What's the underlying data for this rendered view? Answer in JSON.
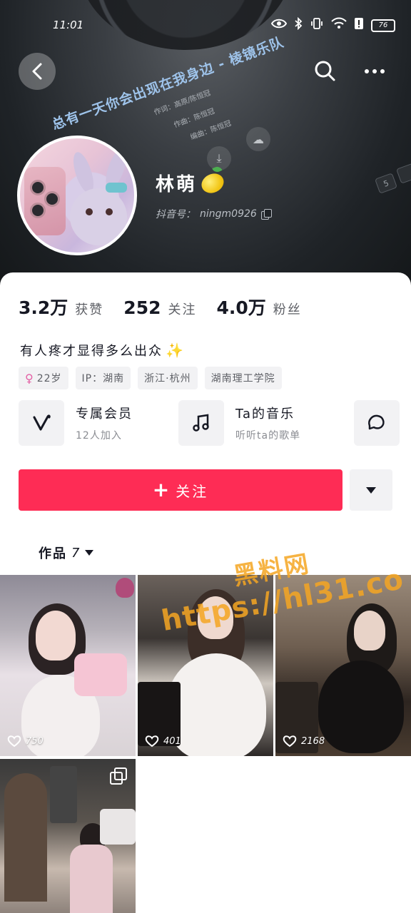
{
  "status_bar": {
    "time": "11:01",
    "battery": "76",
    "icons": [
      "eye-icon",
      "vibrate-icon",
      "bluetooth-icon",
      "wifi-icon",
      "alert-icon",
      "battery-icon"
    ]
  },
  "banner": {
    "lyric": "总有一天你会出现在我身边 - 棱镜乐队",
    "credit_lyrics": "作词：高原/陈恒冠",
    "credit_music": "作曲：陈恒冠",
    "credit_arrange": "编曲：陈恒冠"
  },
  "profile": {
    "name": "林萌",
    "douyin_id_label": "抖音号：",
    "douyin_id": "ningm0926"
  },
  "stats": [
    {
      "value": "3.2万",
      "label": "获赞"
    },
    {
      "value": "252",
      "label": "关注"
    },
    {
      "value": "4.0万",
      "label": "粉丝"
    }
  ],
  "bio": "有人疼才显得多么出众",
  "tags": {
    "age": "22岁",
    "ip": "IP：湖南",
    "location": "浙江·杭州",
    "school": "湖南理工学院"
  },
  "features": [
    {
      "title": "专属会员",
      "subtitle": "12人加入",
      "icon": "v-logo-icon"
    },
    {
      "title": "Ta的音乐",
      "subtitle": "听听ta的歌单",
      "icon": "music-note-icon"
    },
    {
      "title": "",
      "subtitle": "",
      "icon": "chat-bubble-icon"
    }
  ],
  "actions": {
    "follow": "关注"
  },
  "works": {
    "tab_label": "作品",
    "count": "7",
    "items": [
      {
        "likes": "750"
      },
      {
        "likes": "401"
      },
      {
        "likes": "2168"
      },
      {
        "likes": ""
      }
    ]
  },
  "watermark": {
    "line1": "黑料网",
    "line2": "https://hl31.co"
  },
  "colors": {
    "accent": "#fe2c55",
    "text_primary": "#161823",
    "text_secondary": "#5e6066",
    "tag_bg": "#f2f2f4"
  }
}
